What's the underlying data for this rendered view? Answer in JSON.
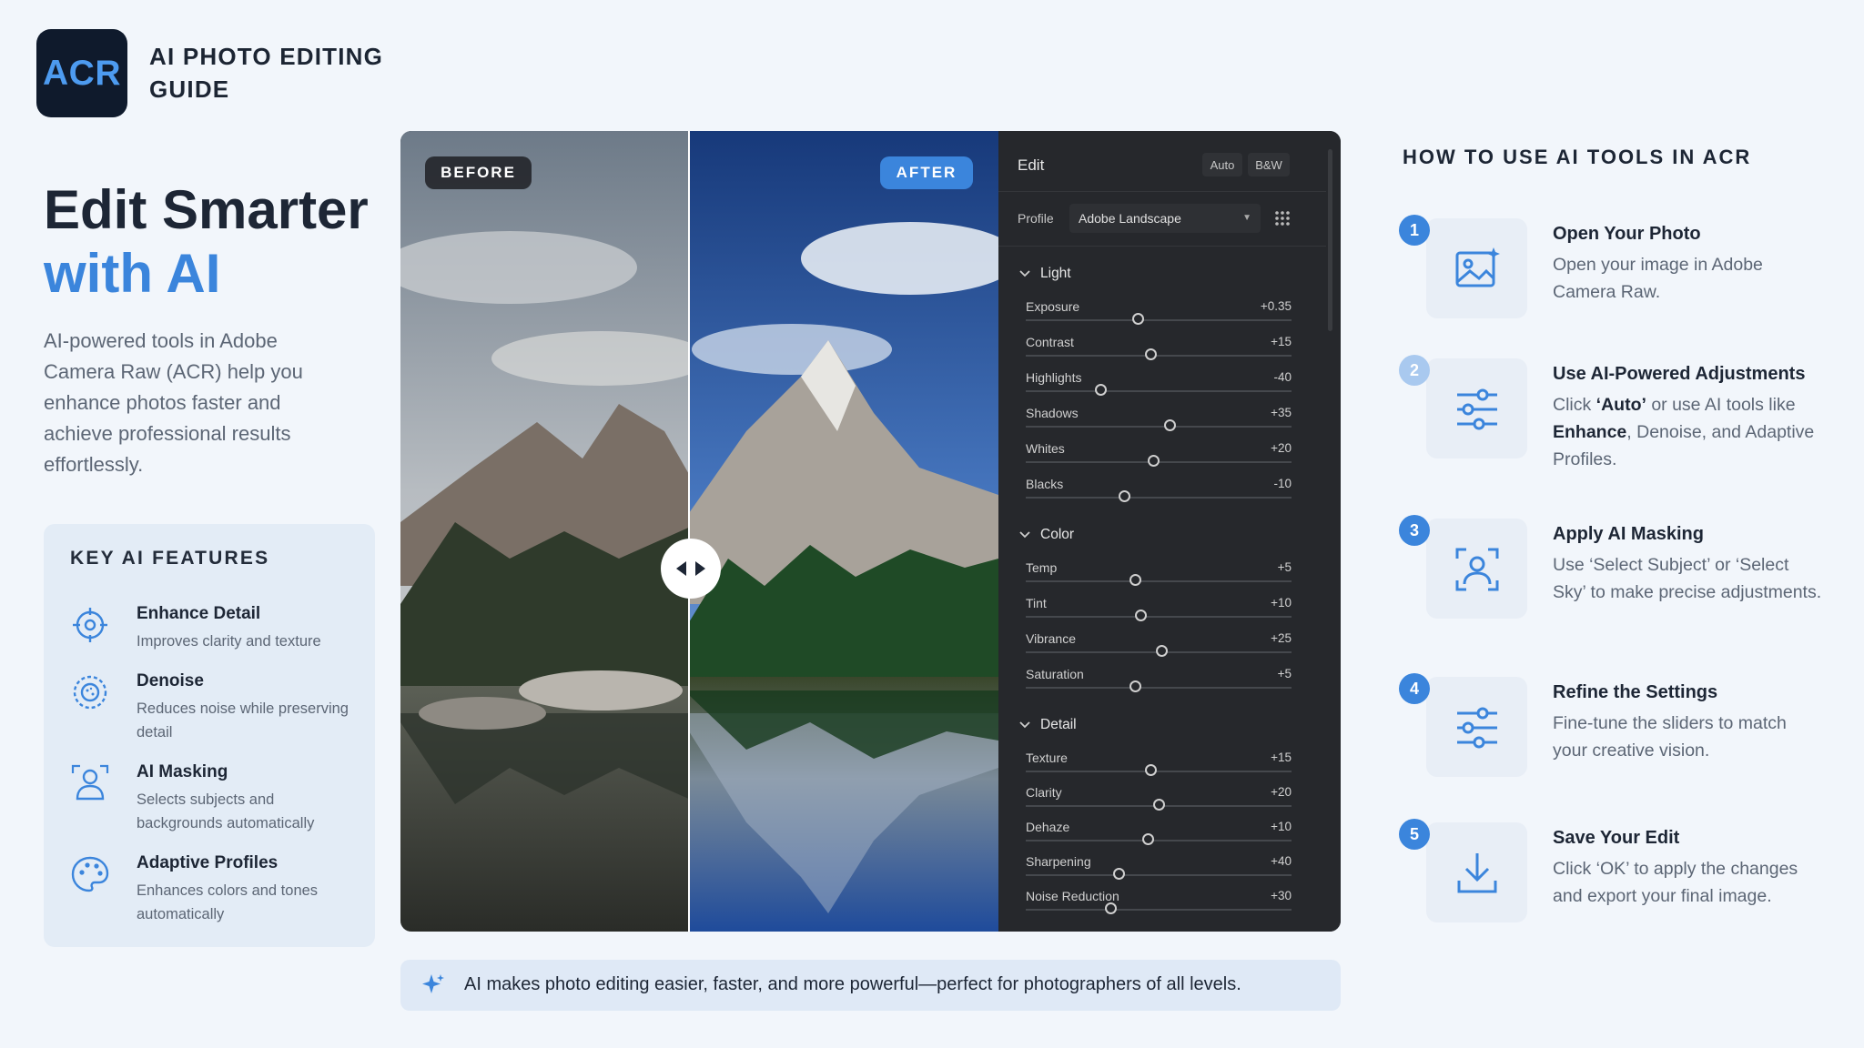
{
  "brand": {
    "logo_text": "ACR",
    "title": "AI PHOTO EDITING GUIDE"
  },
  "hero": {
    "line1": "Edit Smarter",
    "line2": "with AI",
    "intro": "AI-powered tools in Adobe Camera Raw (ACR) help you enhance photos faster and achieve professional results effortlessly."
  },
  "features": {
    "heading": "KEY AI FEATURES",
    "items": [
      {
        "icon": "target-icon",
        "title": "Enhance Detail",
        "desc": "Improves clarity and texture"
      },
      {
        "icon": "denoise-icon",
        "title": "Denoise",
        "desc": "Reduces noise while preserving detail"
      },
      {
        "icon": "masking-icon",
        "title": "AI Masking",
        "desc": "Selects subjects and backgrounds automatically"
      },
      {
        "icon": "palette-icon",
        "title": "Adaptive Profiles",
        "desc": "Enhances colors and tones automatically"
      }
    ]
  },
  "editor": {
    "before_label": "BEFORE",
    "after_label": "AFTER",
    "panel": {
      "title": "Edit",
      "auto_label": "Auto",
      "bw_label": "B&W",
      "profile_label": "Profile",
      "profile_value": "Adobe Landscape",
      "sections": [
        {
          "name": "Light",
          "sliders": [
            {
              "name": "Exposure",
              "value": "+0.35",
              "level": 0.42
            },
            {
              "name": "Contrast",
              "value": "+15",
              "level": 0.47
            },
            {
              "name": "Highlights",
              "value": "-40",
              "level": 0.28
            },
            {
              "name": "Shadows",
              "value": "+35",
              "level": 0.54
            },
            {
              "name": "Whites",
              "value": "+20",
              "level": 0.48
            },
            {
              "name": "Blacks",
              "value": "-10",
              "level": 0.37
            }
          ]
        },
        {
          "name": "Color",
          "sliders": [
            {
              "name": "Temp",
              "value": "+5",
              "level": 0.41
            },
            {
              "name": "Tint",
              "value": "+10",
              "level": 0.43
            },
            {
              "name": "Vibrance",
              "value": "+25",
              "level": 0.51
            },
            {
              "name": "Saturation",
              "value": "+5",
              "level": 0.41
            }
          ]
        },
        {
          "name": "Detail",
          "sliders": [
            {
              "name": "Texture",
              "value": "+15",
              "level": 0.47
            },
            {
              "name": "Clarity",
              "value": "+20",
              "level": 0.5
            },
            {
              "name": "Dehaze",
              "value": "+10",
              "level": 0.46
            },
            {
              "name": "Sharpening",
              "value": "+40",
              "level": 0.35
            },
            {
              "name": "Noise Reduction",
              "value": "+30",
              "level": 0.32
            }
          ]
        }
      ]
    }
  },
  "tip": "AI makes photo editing easier, faster, and more powerful—perfect for photographers of all levels.",
  "how_to": {
    "heading": "HOW TO USE AI TOOLS IN ACR",
    "steps": [
      {
        "num": "1",
        "icon": "image-icon",
        "title": "Open Your Photo",
        "desc": "Open your image in Adobe Camera Raw.",
        "badge_color": "#3b85dc"
      },
      {
        "num": "2",
        "icon": "sliders-icon",
        "title": "Use AI-Powered Adjustments",
        "desc_parts": [
          "Click ",
          "‘Auto’",
          " or use AI tools like ",
          "Enhance",
          ", Denoise, and Adaptive Profiles."
        ],
        "badge_color": "#a9c9ef"
      },
      {
        "num": "3",
        "icon": "subject-select-icon",
        "title": "Apply AI Masking",
        "desc": "Use ‘Select Subject’ or ‘Select Sky’ to make precise adjustments.",
        "badge_color": "#3b85dc"
      },
      {
        "num": "4",
        "icon": "sliders-icon",
        "title": "Refine the Settings",
        "desc": "Fine-tune the sliders to match your creative vision.",
        "badge_color": "#3b85dc"
      },
      {
        "num": "5",
        "icon": "download-icon",
        "title": "Save Your Edit",
        "desc": "Click ‘OK’ to apply the changes and export your final image.",
        "badge_color": "#3b85dc"
      }
    ]
  },
  "colors": {
    "accent": "#3b85dc",
    "background": "#f2f6fb",
    "panel": "#26282c"
  }
}
